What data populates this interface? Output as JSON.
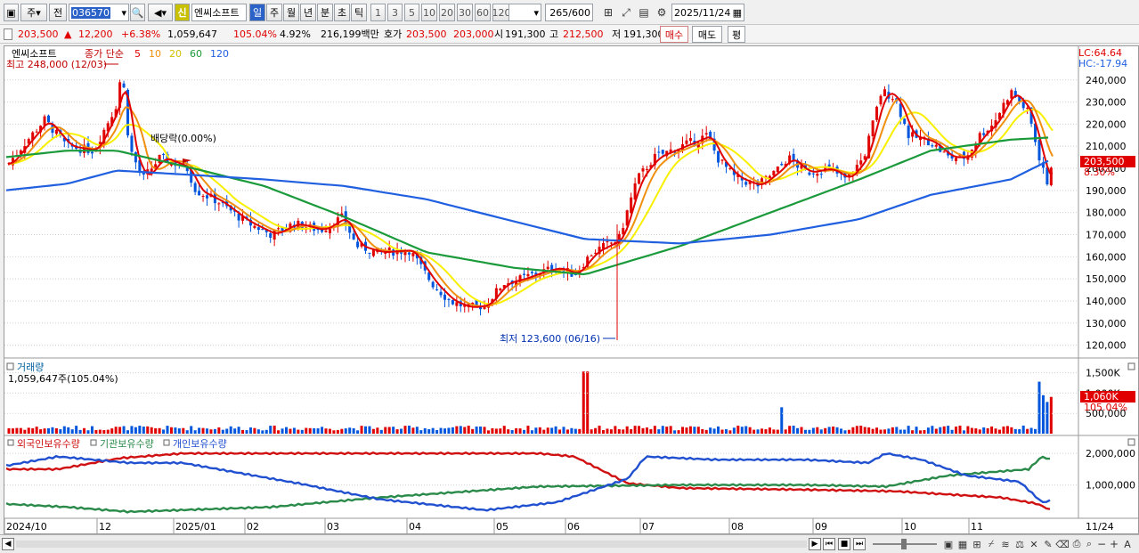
{
  "toolbar": {
    "market_label": "주",
    "mode_label": "전",
    "code": "036570",
    "stock_name": "엔씨소프트",
    "credit_badge": "신",
    "periods": [
      "일",
      "주",
      "월",
      "년",
      "분",
      "초",
      "틱"
    ],
    "intervals": [
      "1",
      "3",
      "5",
      "10",
      "20",
      "30",
      "60",
      "120"
    ],
    "count": "265",
    "count_total": "/600",
    "date": "2025/11/24"
  },
  "quote": {
    "price": "203,500",
    "arrow": "▲",
    "change": "12,200",
    "rate": "+6.38%",
    "volume": "1,059,647",
    "vol_ratio": "105.04%",
    "turnover_rate": "4.92%",
    "amount": "216,199백만",
    "ask_label": "호가",
    "ask": "203,500",
    "bid": "203,000",
    "open_label": "시",
    "open": "191,300",
    "high_label": "고",
    "high": "212,500",
    "low_label": "저",
    "low": "191,300",
    "buy": "매수",
    "sell": "매도",
    "eval": "평"
  },
  "price_panel": {
    "name": "엔씨소프트",
    "ma_label": "종가 단순",
    "ma_periods": [
      "5",
      "10",
      "20",
      "60",
      "120"
    ],
    "lc": "LC:64.64",
    "hc": "HC:-17.94",
    "max_label": "최고 248,000 (12/03)",
    "min_label": "최저 123,600 (06/16)",
    "dividend": "배당락(0.00%)",
    "current": "203,500",
    "current_rate": "8.30%",
    "y_ticks": [
      "240,000",
      "230,000",
      "220,000",
      "210,000",
      "200,000",
      "190,000",
      "180,000",
      "170,000",
      "160,000",
      "150,000",
      "140,000",
      "130,000",
      "120,000"
    ]
  },
  "volume_panel": {
    "title": "거래량",
    "value": "1,059,647주(105.04%)",
    "current": "1,060K",
    "current_rate": "105.04%",
    "y_ticks": [
      "1,500K",
      "1,000K",
      "500,000"
    ]
  },
  "holding_panel": {
    "series": [
      "외국인보유수량",
      "기관보유수량",
      "개인보유수량"
    ],
    "y_ticks": [
      "2,000,000",
      "1,000,000"
    ]
  },
  "x_axis": {
    "labels": [
      "2024/10",
      "12",
      "2025/01",
      "02",
      "03",
      "04",
      "05",
      "06",
      "07",
      "08",
      "09",
      "10",
      "11",
      "11/24"
    ]
  },
  "colors": {
    "up": "#e00000",
    "down": "#0055dd",
    "ma5": "#e00000",
    "ma10": "#f09010",
    "ma20": "#f8f000",
    "ma60": "#1a9a3a",
    "ma120": "#2060e0",
    "foreign": "#d01010",
    "inst": "#2a8a4a",
    "indiv": "#2050d0"
  },
  "chart_data": {
    "type": "line",
    "x": [
      "2024-10",
      "2024-11",
      "2024-12",
      "2025-01",
      "2025-02",
      "2025-03",
      "2025-04",
      "2025-05",
      "2025-06",
      "2025-07",
      "2025-08",
      "2025-09",
      "2025-10",
      "2025-11",
      "2025-11-24"
    ],
    "series": [
      {
        "name": "종가",
        "values": [
          205000,
          215000,
          240000,
          195000,
          172000,
          165000,
          140000,
          152000,
          170000,
          210000,
          195000,
          200000,
          212000,
          225000,
          203500
        ]
      },
      {
        "name": "60",
        "values": [
          205000,
          208000,
          208000,
          200000,
          192000,
          178000,
          162000,
          155000,
          152000,
          165000,
          180000,
          195000,
          208000,
          213000,
          214000
        ]
      },
      {
        "name": "120",
        "values": [
          190000,
          193000,
          199000,
          197000,
          195000,
          192000,
          186000,
          176000,
          168000,
          166000,
          170000,
          177000,
          188000,
          195000,
          204000
        ]
      }
    ],
    "volume": {
      "max_value": 1500000,
      "current": 1059647
    },
    "ylim": [
      115000,
      252000
    ]
  }
}
